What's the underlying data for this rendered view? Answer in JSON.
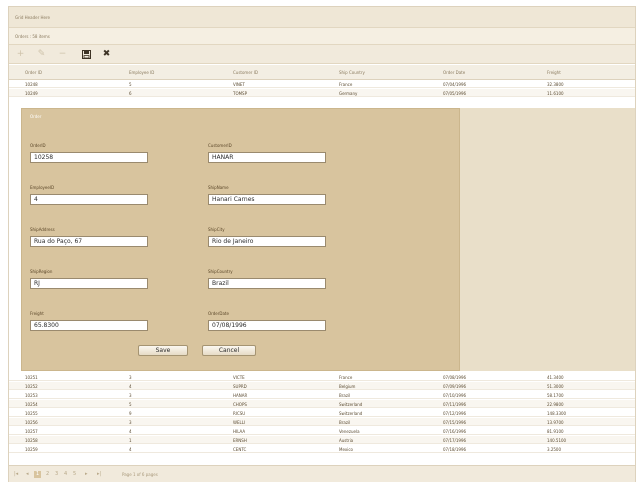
{
  "grid": {
    "title": "Grid Header Here",
    "group_info": "Orders : 58 items"
  },
  "toolbar": {
    "icons": [
      {
        "name": "add-icon",
        "glyph": "+"
      },
      {
        "name": "edit-icon",
        "glyph": "✎"
      },
      {
        "name": "delete-icon",
        "glyph": "−"
      },
      {
        "name": "save-icon",
        "glyph": "💾"
      },
      {
        "name": "cancel-icon",
        "glyph": "✖"
      }
    ]
  },
  "columns": [
    "Order ID",
    "Employee ID",
    "Customer ID",
    "Ship Country",
    "Order Date",
    "Freight"
  ],
  "rows_top": [
    [
      "10248",
      "5",
      "VINET",
      "France",
      "07/04/1996",
      "32.3800"
    ],
    [
      "10249",
      "6",
      "TOMSP",
      "Germany",
      "07/05/1996",
      "11.6100"
    ]
  ],
  "edit_form": {
    "title": "Order",
    "fields": {
      "order_id": {
        "label": "OrderID",
        "value": "10258"
      },
      "customer_id": {
        "label": "CustomerID",
        "value": "HANAR"
      },
      "employee_id": {
        "label": "EmployeeID",
        "value": "4"
      },
      "ship_name": {
        "label": "ShipName",
        "value": "Hanari Carnes"
      },
      "ship_address": {
        "label": "ShipAddress",
        "value": "Rua do Paço, 67"
      },
      "ship_city": {
        "label": "ShipCity",
        "value": "Rio de Janeiro"
      },
      "ship_region": {
        "label": "ShipRegion",
        "value": "RJ"
      },
      "ship_country": {
        "label": "ShipCountry",
        "value": "Brazil"
      },
      "freight": {
        "label": "Freight",
        "value": "65.8300"
      },
      "order_date": {
        "label": "OrderDate",
        "value": "07/08/1996"
      }
    },
    "save_label": "Save",
    "cancel_label": "Cancel"
  },
  "rows_bottom": [
    [
      "10251",
      "3",
      "VICTE",
      "France",
      "07/08/1996",
      "41.3400"
    ],
    [
      "10252",
      "4",
      "SUPRD",
      "Belgium",
      "07/09/1996",
      "51.3000"
    ],
    [
      "10253",
      "3",
      "HANAR",
      "Brazil",
      "07/10/1996",
      "58.1700"
    ],
    [
      "10254",
      "5",
      "CHOPS",
      "Switzerland",
      "07/11/1996",
      "22.9800"
    ],
    [
      "10255",
      "9",
      "RICSU",
      "Switzerland",
      "07/12/1996",
      "148.3300"
    ],
    [
      "10256",
      "3",
      "WELLI",
      "Brazil",
      "07/15/1996",
      "13.9700"
    ],
    [
      "10257",
      "4",
      "HILAA",
      "Venezuela",
      "07/16/1996",
      "81.9100"
    ],
    [
      "10258",
      "1",
      "ERNSH",
      "Austria",
      "07/17/1996",
      "140.5100"
    ],
    [
      "10259",
      "4",
      "CENTC",
      "Mexico",
      "07/18/1996",
      "3.2500"
    ]
  ],
  "pager": {
    "first": "|◂",
    "prev": "◂",
    "pages": [
      "1",
      "2",
      "3",
      "4",
      "5"
    ],
    "current": "1",
    "next": "▸",
    "last": "▸|",
    "info": "Page 1 of 6 pages"
  }
}
